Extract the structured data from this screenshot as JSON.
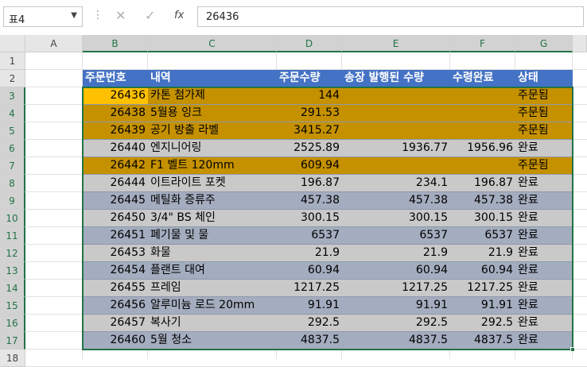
{
  "name_box": "표4",
  "formula": {
    "cancel_icon": "close-icon",
    "enter_icon": "check-icon",
    "fx_label": "fx",
    "value": "26436"
  },
  "columns": [
    "A",
    "B",
    "C",
    "D",
    "E",
    "F",
    "G"
  ],
  "rows": [
    "1",
    "2",
    "3",
    "4",
    "5",
    "6",
    "7",
    "8",
    "9",
    "10",
    "11",
    "12",
    "13",
    "14",
    "15",
    "16",
    "17",
    "18"
  ],
  "table": {
    "headers": [
      "주문번호",
      "내역",
      "주문수량",
      "송장 발행된 수량",
      "수령완료",
      "상태"
    ],
    "rows": [
      [
        "26436",
        "카톤 첨가제",
        "144",
        "",
        "",
        "주문됨"
      ],
      [
        "26438",
        "5월용 잉크",
        "291.53",
        "",
        "",
        "주문됨"
      ],
      [
        "26439",
        "공기 방출 라벨",
        "3415.27",
        "",
        "",
        "주문됨"
      ],
      [
        "26440",
        "엔지니어링",
        "2525.89",
        "1936.77",
        "1956.96",
        "완료"
      ],
      [
        "26442",
        "F1 벨트 120mm",
        "609.94",
        "",
        "",
        "주문됨"
      ],
      [
        "26444",
        "이트라이트 포켓",
        "196.87",
        "234.1",
        "196.87",
        "완료"
      ],
      [
        "26445",
        "메틸화 증류주",
        "457.38",
        "457.38",
        "457.38",
        "완료"
      ],
      [
        "26450",
        "3/4\" BS 체인",
        "300.15",
        "300.15",
        "300.15",
        "완료"
      ],
      [
        "26451",
        "폐기물 및 물",
        "6537",
        "6537",
        "6537",
        "완료"
      ],
      [
        "26453",
        "화물",
        "21.9",
        "21.9",
        "21.9",
        "완료"
      ],
      [
        "26454",
        "플랜트 대여",
        "60.94",
        "60.94",
        "60.94",
        "완료"
      ],
      [
        "26455",
        "프레임",
        "1217.25",
        "1217.25",
        "1217.25",
        "완료"
      ],
      [
        "26456",
        "알루미늄 로드 20mm",
        "91.91",
        "91.91",
        "91.91",
        "완료"
      ],
      [
        "26457",
        "복사기",
        "292.5",
        "292.5",
        "292.5",
        "완료"
      ],
      [
        "26460",
        "5월 청소",
        "4837.5",
        "4837.5",
        "4837.5",
        "완료"
      ]
    ],
    "row_fill": [
      "#c59100",
      "#c59100",
      "#c59100",
      "#c9c9c9",
      "#c59100",
      "#c9c9c9",
      "#a4adbf",
      "#c9c9c9",
      "#a4adbf",
      "#c9c9c9",
      "#a4adbf",
      "#c9c9c9",
      "#a4adbf",
      "#c9c9c9",
      "#a4adbf"
    ],
    "header_fill": "#4472c4",
    "selection_color": "#217346",
    "active_cell_fill": "#ffc000"
  }
}
